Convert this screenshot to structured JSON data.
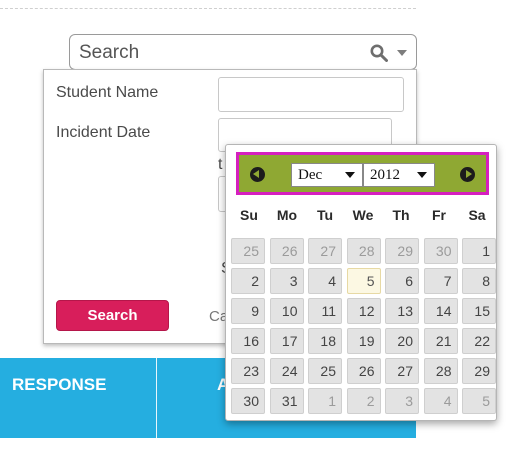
{
  "search_bar": {
    "placeholder": "Search",
    "icon": "magnifier-icon",
    "dropdown_icon": "chevron-down-icon"
  },
  "search_panel": {
    "student_name_label": "Student Name",
    "incident_date_label": "Incident Date",
    "partial_text_t": "t",
    "partial_text_s": "S",
    "partial_text_ca": "Ca",
    "search_button_label": "Search",
    "search_button_color": "#d81e5b"
  },
  "table": {
    "header_color": "#25aee0",
    "columns": [
      "RESPONSE",
      "A"
    ]
  },
  "calendar": {
    "month": "Dec",
    "year": "2012",
    "header_color": "#8fa833",
    "highlight_color": "#d61fbf",
    "weekdays": [
      "Su",
      "Mo",
      "Tu",
      "We",
      "Th",
      "Fr",
      "Sa"
    ],
    "weeks": [
      [
        {
          "d": "25",
          "o": true
        },
        {
          "d": "26",
          "o": true
        },
        {
          "d": "27",
          "o": true
        },
        {
          "d": "28",
          "o": true
        },
        {
          "d": "29",
          "o": true
        },
        {
          "d": "30",
          "o": true
        },
        {
          "d": "1",
          "o": false
        }
      ],
      [
        {
          "d": "2",
          "o": false
        },
        {
          "d": "3",
          "o": false
        },
        {
          "d": "4",
          "o": false
        },
        {
          "d": "5",
          "o": false,
          "today": true
        },
        {
          "d": "6",
          "o": false
        },
        {
          "d": "7",
          "o": false
        },
        {
          "d": "8",
          "o": false
        }
      ],
      [
        {
          "d": "9",
          "o": false
        },
        {
          "d": "10",
          "o": false
        },
        {
          "d": "11",
          "o": false
        },
        {
          "d": "12",
          "o": false
        },
        {
          "d": "13",
          "o": false
        },
        {
          "d": "14",
          "o": false
        },
        {
          "d": "15",
          "o": false
        }
      ],
      [
        {
          "d": "16",
          "o": false
        },
        {
          "d": "17",
          "o": false
        },
        {
          "d": "18",
          "o": false
        },
        {
          "d": "19",
          "o": false
        },
        {
          "d": "20",
          "o": false
        },
        {
          "d": "21",
          "o": false
        },
        {
          "d": "22",
          "o": false
        }
      ],
      [
        {
          "d": "23",
          "o": false
        },
        {
          "d": "24",
          "o": false
        },
        {
          "d": "25",
          "o": false
        },
        {
          "d": "26",
          "o": false
        },
        {
          "d": "27",
          "o": false
        },
        {
          "d": "28",
          "o": false
        },
        {
          "d": "29",
          "o": false
        }
      ],
      [
        {
          "d": "30",
          "o": false
        },
        {
          "d": "31",
          "o": false
        },
        {
          "d": "1",
          "o": true
        },
        {
          "d": "2",
          "o": true
        },
        {
          "d": "3",
          "o": true
        },
        {
          "d": "4",
          "o": true
        },
        {
          "d": "5",
          "o": true
        }
      ]
    ]
  }
}
